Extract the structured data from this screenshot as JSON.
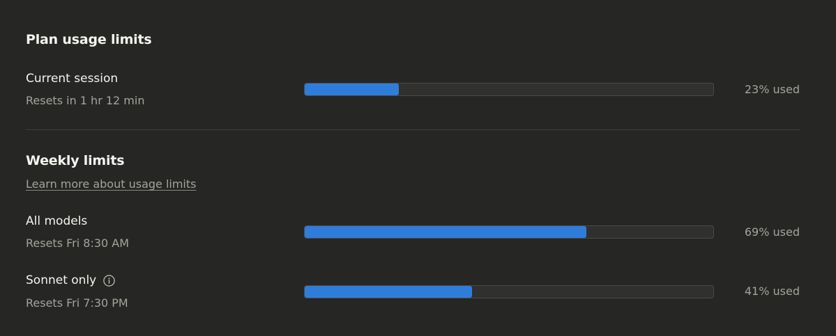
{
  "plan": {
    "title": "Plan usage limits",
    "session": {
      "label": "Current session",
      "reset": "Resets in 1 hr 12 min",
      "usage_fraction": 0.23,
      "usage_text": "23% used"
    }
  },
  "weekly": {
    "title": "Weekly limits",
    "learn_more": "Learn more about usage limits",
    "all_models": {
      "label": "All models",
      "reset": "Resets Fri 8:30 AM",
      "usage_fraction": 0.69,
      "usage_text": "69% used"
    },
    "sonnet": {
      "label": "Sonnet only",
      "reset": "Resets Fri 7:30 PM",
      "usage_fraction": 0.41,
      "usage_text": "41% used",
      "icon": "info-icon"
    }
  },
  "colors": {
    "background": "#262624",
    "bar_fill": "#2f7ddb",
    "bar_track": "#30302e"
  }
}
